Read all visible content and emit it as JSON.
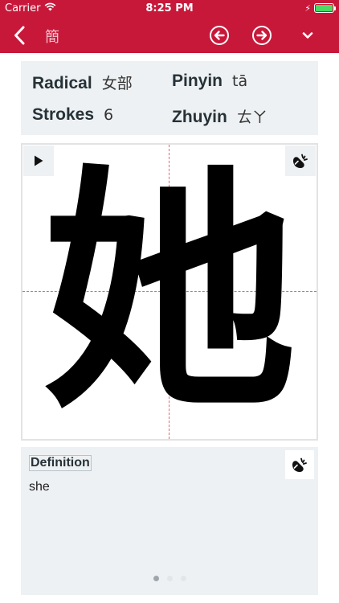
{
  "status_bar": {
    "carrier": "Carrier",
    "time": "8:25 PM",
    "battery_level": 1.0
  },
  "nav": {
    "title": "簡",
    "back_icon": "chevron-left-icon",
    "prev_icon": "arrow-left-circle-icon",
    "next_icon": "arrow-right-circle-icon",
    "more_icon": "chevron-down-icon"
  },
  "info": {
    "radical_label": "Radical",
    "radical_value": "女部",
    "pinyin_label": "Pinyin",
    "pinyin_value": "tā",
    "strokes_label": "Strokes",
    "strokes_value": "6",
    "zhuyin_label": "Zhuyin",
    "zhuyin_value": "ㄊㄚ"
  },
  "character": {
    "glyph": "她",
    "play_icon": "play-icon",
    "speak_icon": "speaker-icon"
  },
  "definition": {
    "title": "Definition",
    "text": "she",
    "speak_icon": "speaker-icon"
  },
  "pagination": {
    "pages": 3,
    "current": 1
  },
  "colors": {
    "header": "#c8183a",
    "card_bg": "#eef1f3",
    "guide": "#e8646a",
    "battery": "#4cd964"
  }
}
